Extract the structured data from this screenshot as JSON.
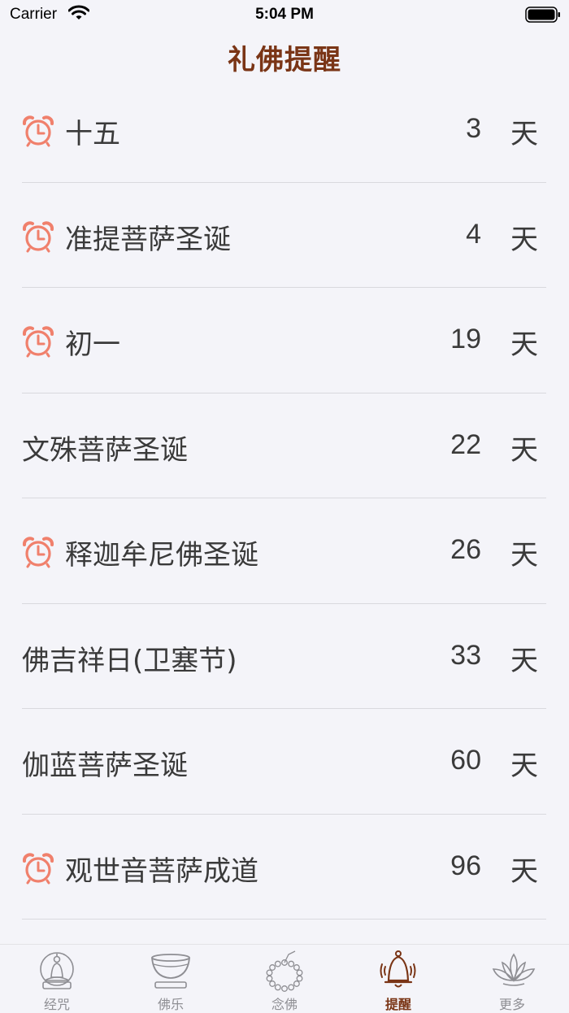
{
  "status_bar": {
    "carrier": "Carrier",
    "time": "5:04 PM"
  },
  "header": {
    "title": "礼佛提醒"
  },
  "reminders": [
    {
      "name": "十五",
      "days": "3",
      "unit": "天",
      "alarm": true
    },
    {
      "name": "准提菩萨圣诞",
      "days": "4",
      "unit": "天",
      "alarm": true
    },
    {
      "name": "初一",
      "days": "19",
      "unit": "天",
      "alarm": true
    },
    {
      "name": "文殊菩萨圣诞",
      "days": "22",
      "unit": "天",
      "alarm": false
    },
    {
      "name": "释迦牟尼佛圣诞",
      "days": "26",
      "unit": "天",
      "alarm": true
    },
    {
      "name": "佛吉祥日(卫塞节)",
      "days": "33",
      "unit": "天",
      "alarm": false
    },
    {
      "name": "伽蓝菩萨圣诞",
      "days": "60",
      "unit": "天",
      "alarm": false
    },
    {
      "name": "观世音菩萨成道",
      "days": "96",
      "unit": "天",
      "alarm": true
    }
  ],
  "tab_bar": {
    "tabs": [
      {
        "label": "经咒",
        "icon": "buddha-icon",
        "active": false
      },
      {
        "label": "佛乐",
        "icon": "singing-bowl-icon",
        "active": false
      },
      {
        "label": "念佛",
        "icon": "prayer-beads-icon",
        "active": false
      },
      {
        "label": "提醒",
        "icon": "bell-icon",
        "active": true
      },
      {
        "label": "更多",
        "icon": "lotus-icon",
        "active": false
      }
    ]
  },
  "colors": {
    "accent": "#7a3516",
    "alarm": "#f0806c",
    "inactive": "#8e8e93",
    "background": "#f4f4f9"
  }
}
